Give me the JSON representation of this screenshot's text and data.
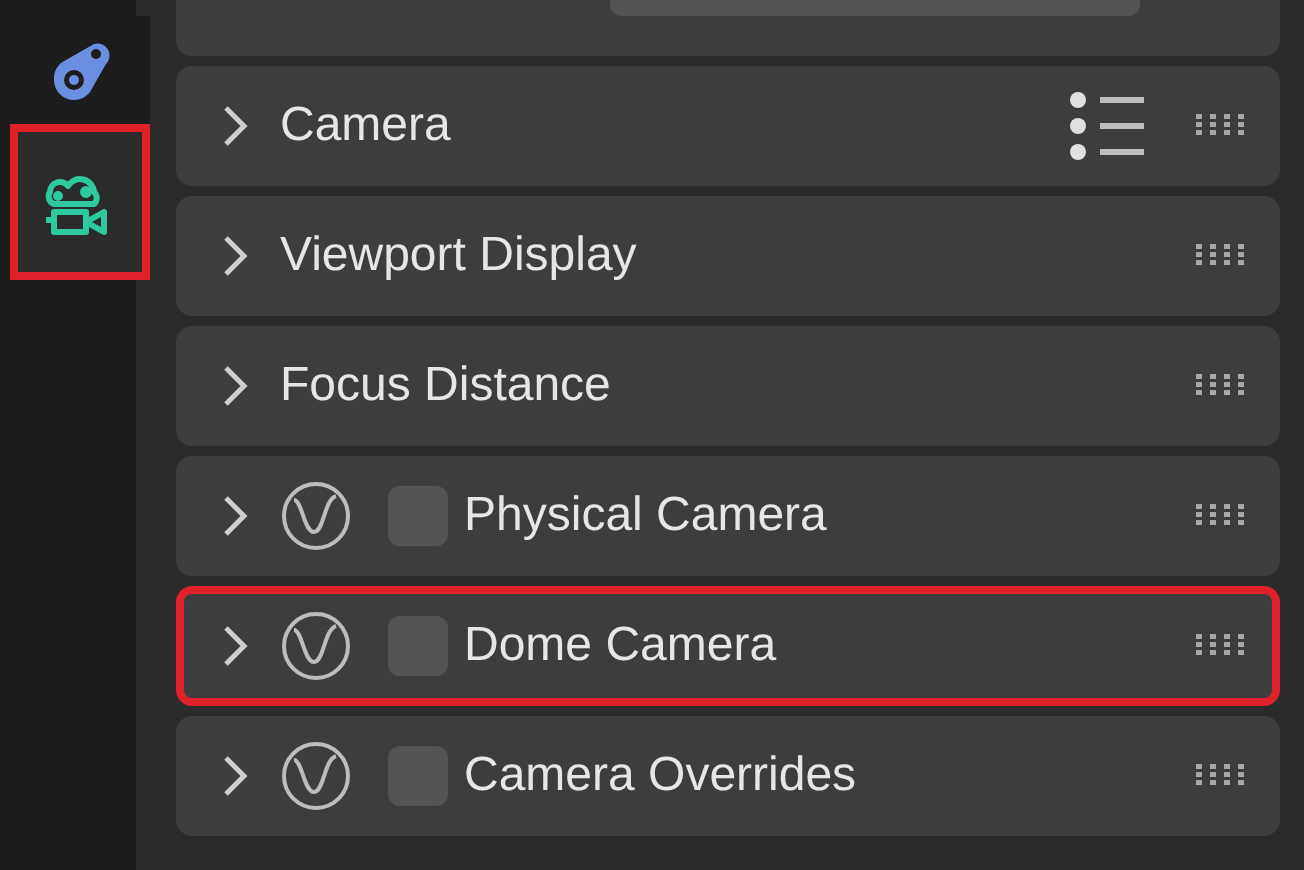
{
  "sidebar": {
    "tabs": [
      {
        "kind": "object-data",
        "selected": false,
        "highlighted": false
      },
      {
        "kind": "camera",
        "selected": true,
        "highlighted": true
      }
    ]
  },
  "panels": [
    {
      "kind": "presets",
      "title": "Camera",
      "expanded": false,
      "highlighted": false
    },
    {
      "kind": "plain",
      "title": "Viewport Display",
      "expanded": false,
      "highlighted": false
    },
    {
      "kind": "plain",
      "title": "Focus Distance",
      "expanded": false,
      "highlighted": false
    },
    {
      "kind": "toggle",
      "title": "Physical Camera",
      "expanded": false,
      "checked": false,
      "highlighted": false
    },
    {
      "kind": "toggle",
      "title": "Dome Camera",
      "expanded": false,
      "checked": false,
      "highlighted": true
    },
    {
      "kind": "toggle",
      "title": "Camera Overrides",
      "expanded": false,
      "checked": false,
      "highlighted": false
    }
  ]
}
